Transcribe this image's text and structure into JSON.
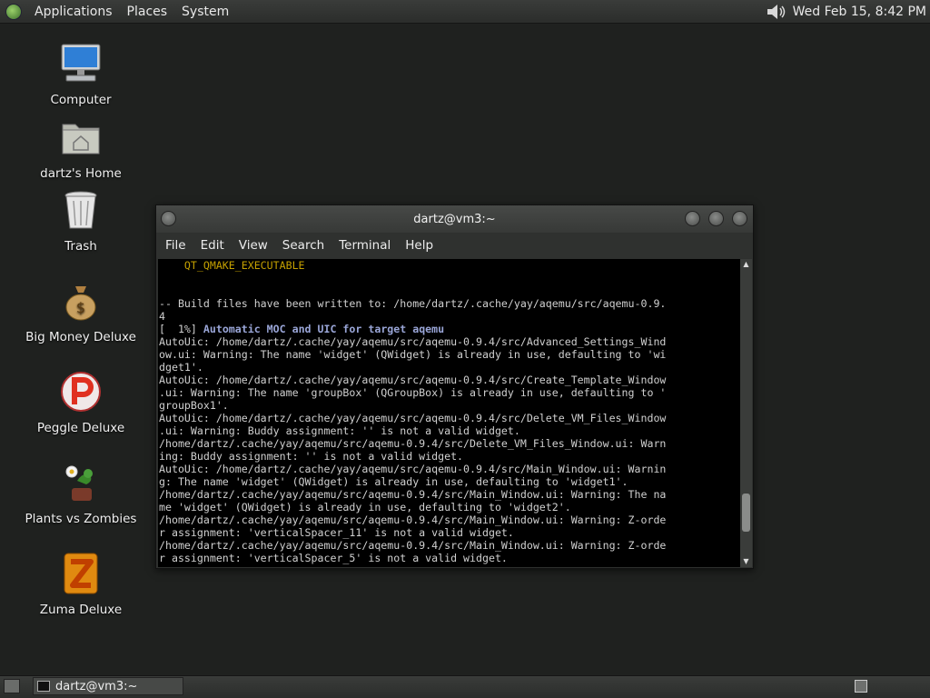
{
  "top_panel": {
    "menus": [
      "Applications",
      "Places",
      "System"
    ],
    "clock": "Wed Feb 15,  8:42 PM"
  },
  "desktop_icons": [
    {
      "label": "Computer",
      "icon": "computer-icon"
    },
    {
      "label": "dartz's Home",
      "icon": "home-folder-icon"
    },
    {
      "label": "Trash",
      "icon": "trash-icon"
    },
    {
      "label": "Big Money Deluxe",
      "icon": "money-bag-icon"
    },
    {
      "label": "Peggle Deluxe",
      "icon": "peggle-icon"
    },
    {
      "label": "Plants vs Zombies",
      "icon": "plants-icon"
    },
    {
      "label": "Zuma Deluxe",
      "icon": "zuma-icon"
    }
  ],
  "terminal": {
    "title": "dartz@vm3:~",
    "menus": [
      "File",
      "Edit",
      "View",
      "Search",
      "Terminal",
      "Help"
    ],
    "lines": [
      {
        "text": "    QT_QMAKE_EXECUTABLE",
        "style": "orange"
      },
      {
        "text": "",
        "style": ""
      },
      {
        "text": "",
        "style": ""
      },
      {
        "text": "-- Build files have been written to: /home/dartz/.cache/yay/aqemu/src/aqemu-0.9.",
        "style": ""
      },
      {
        "text": "4",
        "style": ""
      },
      {
        "text": "[  1%] ",
        "style": "",
        "bold": "Automatic MOC and UIC for target aqemu"
      },
      {
        "text": "AutoUic: /home/dartz/.cache/yay/aqemu/src/aqemu-0.9.4/src/Advanced_Settings_Wind",
        "style": ""
      },
      {
        "text": "ow.ui: Warning: The name 'widget' (QWidget) is already in use, defaulting to 'wi",
        "style": ""
      },
      {
        "text": "dget1'.",
        "style": ""
      },
      {
        "text": "AutoUic: /home/dartz/.cache/yay/aqemu/src/aqemu-0.9.4/src/Create_Template_Window",
        "style": ""
      },
      {
        "text": ".ui: Warning: The name 'groupBox' (QGroupBox) is already in use, defaulting to '",
        "style": ""
      },
      {
        "text": "groupBox1'.",
        "style": ""
      },
      {
        "text": "AutoUic: /home/dartz/.cache/yay/aqemu/src/aqemu-0.9.4/src/Delete_VM_Files_Window",
        "style": ""
      },
      {
        "text": ".ui: Warning: Buddy assignment: '' is not a valid widget.",
        "style": ""
      },
      {
        "text": "/home/dartz/.cache/yay/aqemu/src/aqemu-0.9.4/src/Delete_VM_Files_Window.ui: Warn",
        "style": ""
      },
      {
        "text": "ing: Buddy assignment: '' is not a valid widget.",
        "style": ""
      },
      {
        "text": "AutoUic: /home/dartz/.cache/yay/aqemu/src/aqemu-0.9.4/src/Main_Window.ui: Warnin",
        "style": ""
      },
      {
        "text": "g: The name 'widget' (QWidget) is already in use, defaulting to 'widget1'.",
        "style": ""
      },
      {
        "text": "/home/dartz/.cache/yay/aqemu/src/aqemu-0.9.4/src/Main_Window.ui: Warning: The na",
        "style": ""
      },
      {
        "text": "me 'widget' (QWidget) is already in use, defaulting to 'widget2'.",
        "style": ""
      },
      {
        "text": "/home/dartz/.cache/yay/aqemu/src/aqemu-0.9.4/src/Main_Window.ui: Warning: Z-orde",
        "style": ""
      },
      {
        "text": "r assignment: 'verticalSpacer_11' is not a valid widget.",
        "style": ""
      },
      {
        "text": "/home/dartz/.cache/yay/aqemu/src/aqemu-0.9.4/src/Main_Window.ui: Warning: Z-orde",
        "style": ""
      },
      {
        "text": "r assignment: 'verticalSpacer_5' is not a valid widget.",
        "style": ""
      }
    ]
  },
  "taskbar": {
    "items": [
      {
        "label": "dartz@vm3:~"
      }
    ]
  },
  "colors": {
    "desktop_bg": "#1f211f",
    "terminal_bg": "#000000",
    "terminal_fg": "#d0d0d0",
    "orange": "#c4a000",
    "bold_blue": "#9aa6d8"
  }
}
